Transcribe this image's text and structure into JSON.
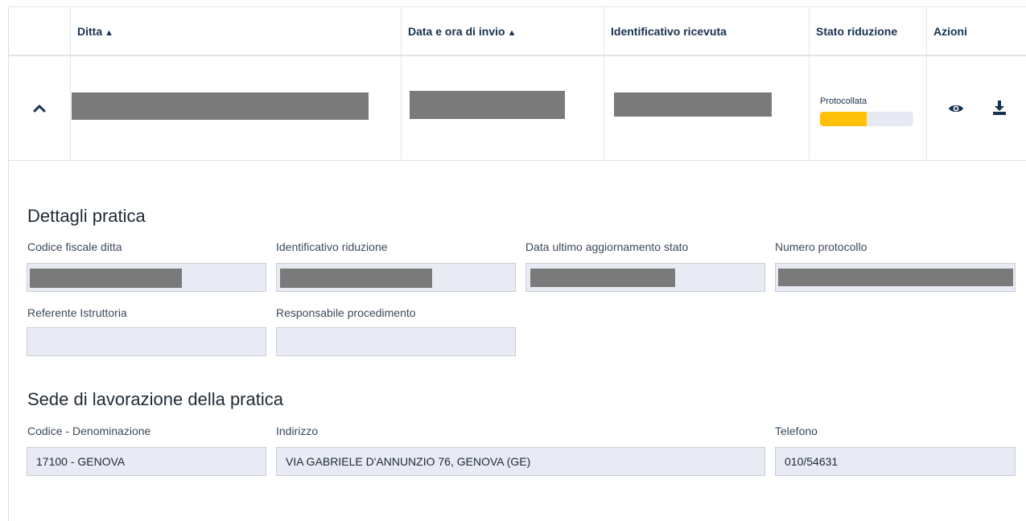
{
  "table": {
    "headers": {
      "ditta": "Ditta",
      "data_invio": "Data e ora di invio",
      "identificativo": "Identificativo ricevuta",
      "stato": "Stato riduzione",
      "azioni": "Azioni"
    },
    "row": {
      "stato_label": "Protocollata",
      "stato_progress": 0.5
    }
  },
  "details": {
    "title": "Dettagli pratica",
    "labels": {
      "codice_fiscale": "Codice fiscale ditta",
      "identificativo_riduzione": "Identificativo riduzione",
      "data_aggiornamento": "Data ultimo aggiornamento stato",
      "numero_protocollo": "Numero protocollo",
      "referente": "Referente Istruttoria",
      "responsabile": "Responsabile procedimento"
    }
  },
  "sede": {
    "title": "Sede di lavorazione della pratica",
    "labels": {
      "codice": "Codice - Denominazione",
      "indirizzo": "Indirizzo",
      "telefono": "Telefono"
    },
    "values": {
      "codice": "17100 - GENOVA",
      "indirizzo": "VIA GABRIELE D'ANNUNZIO 76, GENOVA (GE)",
      "telefono": "010/54631"
    }
  },
  "colors": {
    "progress_fill": "#ffc107",
    "field_bg": "#e8ebf3",
    "redaction": "#7a7a7a"
  },
  "icons": {
    "sort": "sort-icon",
    "expand": "chevron-up-icon",
    "view": "eye-icon",
    "download": "download-icon"
  }
}
